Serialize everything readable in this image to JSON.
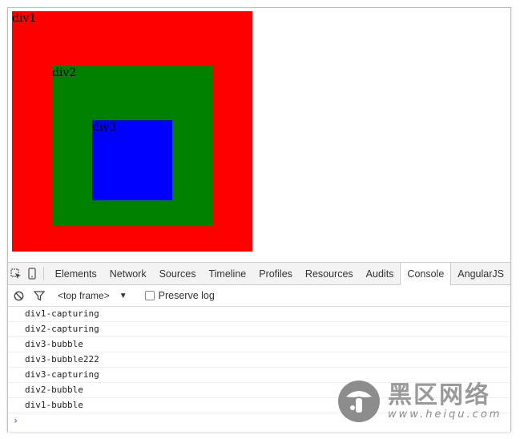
{
  "page": {
    "boxes": [
      {
        "label": "div1",
        "color": "#ff0000"
      },
      {
        "label": "div2",
        "color": "#008000"
      },
      {
        "label": "div3",
        "color": "#0000ff"
      }
    ]
  },
  "devtools": {
    "tabs": [
      "Elements",
      "Network",
      "Sources",
      "Timeline",
      "Profiles",
      "Resources",
      "Audits",
      "Console",
      "AngularJS"
    ],
    "active_tab": "Console",
    "toolbar": {
      "frame_selector": "<top frame>",
      "preserve_log_label": "Preserve log",
      "preserve_log_checked": false
    },
    "console_lines": [
      "div1-capturing",
      "div2-capturing",
      "div3-bubble",
      "div3-bubble222",
      "div3-capturing",
      "div2-bubble",
      "div1-bubble"
    ],
    "prompt": "›",
    "accent": "#367cf1"
  },
  "watermark": {
    "title": "黑区网络",
    "url": "www.heiqu.com"
  }
}
